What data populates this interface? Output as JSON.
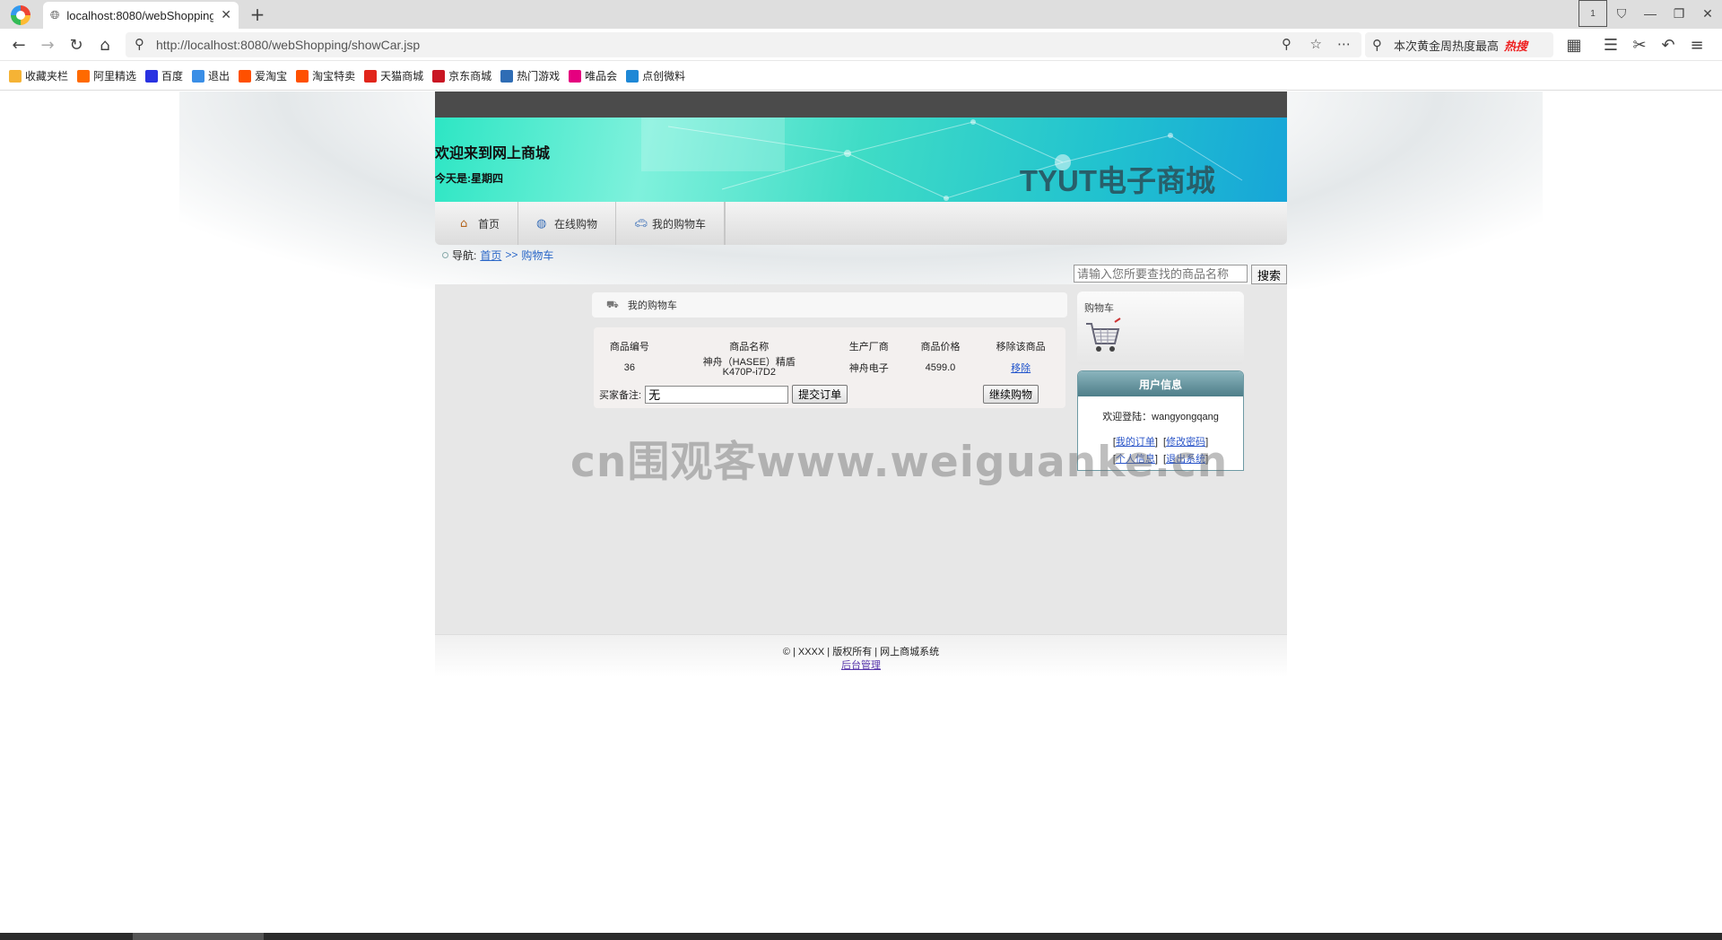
{
  "browser": {
    "tab_title": "localhost:8080/webShopping/showCar.jsp",
    "url_path": "http://localhost:8080/webShopping/showCar.jsp",
    "url_host": "localhost",
    "hot_search_text": "本次黄金周热度最高",
    "hot_badge": "热搜",
    "tab_count": "1"
  },
  "bookmarks": [
    {
      "label": "收藏夹栏",
      "color": "#f5b335"
    },
    {
      "label": "阿里精选",
      "color": "#ff6a00"
    },
    {
      "label": "百度",
      "color": "#2932e1"
    },
    {
      "label": "退出",
      "color": "#3a8ee6"
    },
    {
      "label": "爱淘宝",
      "color": "#ff5000"
    },
    {
      "label": "淘宝特卖",
      "color": "#ff5000"
    },
    {
      "label": "天猫商城",
      "color": "#e1251b"
    },
    {
      "label": "京东商城",
      "color": "#c91623"
    },
    {
      "label": "热门游戏",
      "color": "#2f6db5"
    },
    {
      "label": "唯品会",
      "color": "#e5007f"
    },
    {
      "label": "点创微料",
      "color": "#1e88d6"
    }
  ],
  "site": {
    "welcome": "欢迎来到网上商城",
    "today": "今天是:星期四",
    "brand": "TYUT电子商城",
    "menu": [
      "首页",
      "在线购物",
      "我的购物车"
    ],
    "crumb_prefix": "导航:",
    "crumb_home": "首页",
    "crumb_sep": ">>",
    "crumb_current": "购物车",
    "search_placeholder": "请输入您所要查找的商品名称",
    "search_button": "搜索"
  },
  "cart": {
    "heading": "我的购物车",
    "columns": [
      "商品编号",
      "商品名称",
      "生产厂商",
      "商品价格",
      "移除该商品"
    ],
    "rows": [
      {
        "id": "36",
        "name_line1": "神舟（HASEE）精盾",
        "name_line2": "K470P-i7D2",
        "maker": "神舟电子",
        "price": "4599.0",
        "action": "移除"
      }
    ],
    "remark_label": "买家备注:",
    "remark_value": "无",
    "submit_button": "提交订单",
    "continue_button": "继续购物"
  },
  "sidebar": {
    "cart_title": "购物车",
    "user_header": "用户信息",
    "welcome_user": "欢迎登陆：wangyongqang",
    "links": [
      "我的订单",
      "修改密码",
      "个人信息",
      "退出系统"
    ]
  },
  "footer": {
    "copyright": "© | XXXX | 版权所有 | 网上商城系统",
    "admin_link": "后台管理"
  },
  "watermark": "cn围观客www.weiguanke.cn"
}
